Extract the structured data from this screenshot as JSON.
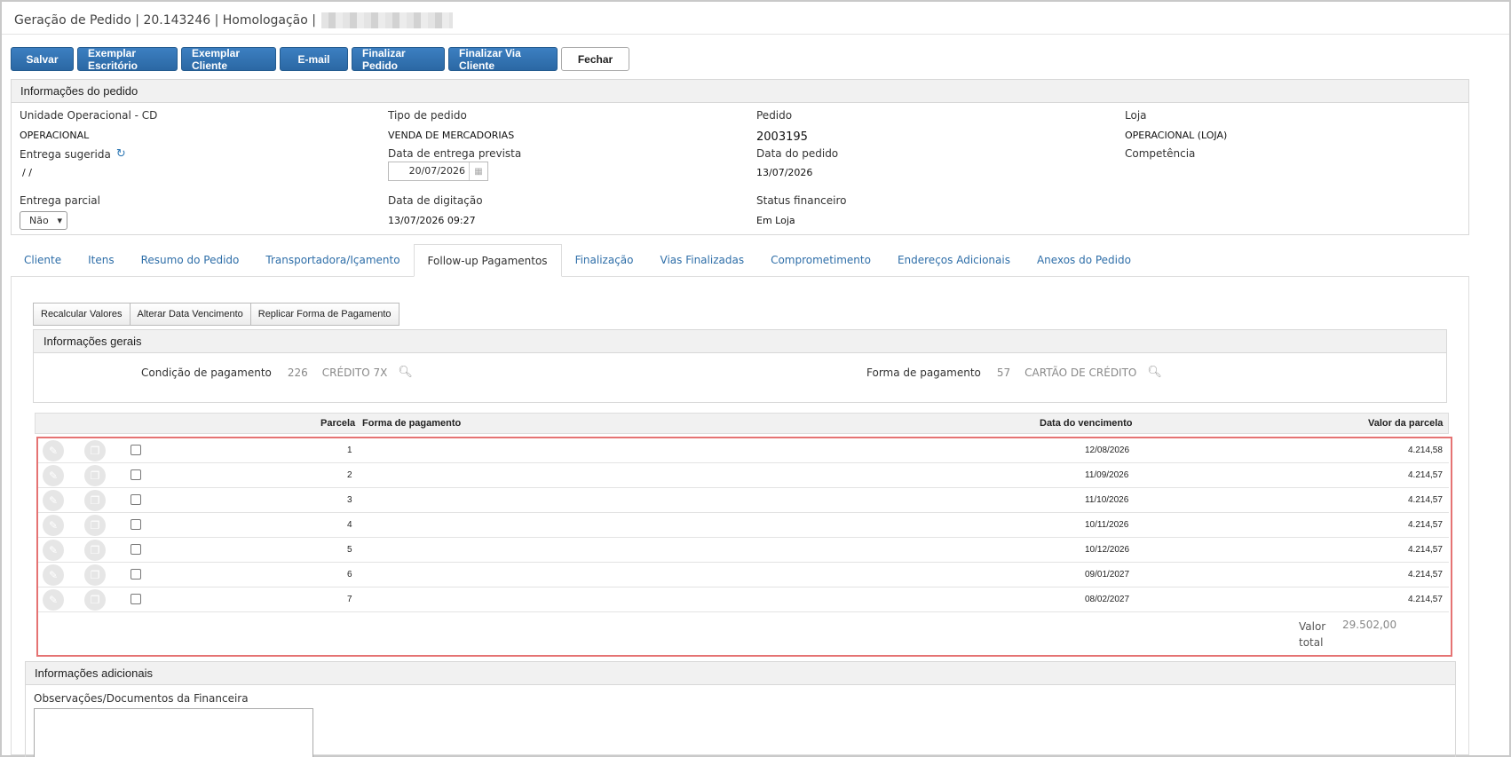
{
  "header": {
    "title": "Geração de Pedido | 20.143246 | Homologação |"
  },
  "toolbar": {
    "buttons": [
      "Salvar",
      "Exemplar Escritório",
      "Exemplar Cliente",
      "E-mail",
      "Finalizar Pedido",
      "Finalizar Via Cliente",
      "Fechar"
    ]
  },
  "order_info": {
    "title": "Informações do pedido",
    "unidade_label": "Unidade Operacional - CD",
    "unidade_value": "OPERACIONAL",
    "tipo_label": "Tipo de pedido",
    "tipo_value": "VENDA DE MERCADORIAS",
    "pedido_label": "Pedido",
    "pedido_value": "2003195",
    "loja_label": "Loja",
    "loja_value": "OPERACIONAL (LOJA)",
    "entrega_sugerida_label": "Entrega sugerida",
    "entrega_sugerida_value": "/ /",
    "data_entrega_label": "Data de entrega prevista",
    "data_entrega_value": "20/07/2026",
    "data_pedido_label": "Data do pedido",
    "data_pedido_value": "13/07/2026",
    "competencia_label": "Competência",
    "entrega_parcial_label": "Entrega parcial",
    "entrega_parcial_value": "Não",
    "data_digitacao_label": "Data de digitação",
    "data_digitacao_value": "13/07/2026 09:27",
    "status_label": "Status financeiro",
    "status_value": "Em Loja"
  },
  "tabs": [
    "Cliente",
    "Itens",
    "Resumo do Pedido",
    "Transportadora/Içamento",
    "Follow-up Pagamentos",
    "Finalização",
    "Vias Finalizadas",
    "Comprometimento",
    "Endereços Adicionais",
    "Anexos do Pedido"
  ],
  "sub_toolbar": [
    "Recalcular Valores",
    "Alterar Data Vencimento",
    "Replicar Forma de Pagamento"
  ],
  "general_info": {
    "title": "Informações gerais",
    "condicao_label": "Condição de pagamento",
    "condicao_code": "226",
    "condicao_desc": "CRÉDITO 7X",
    "forma_label": "Forma de pagamento",
    "forma_code": "57",
    "forma_desc": "CARTÃO DE CRÉDITO"
  },
  "installments": {
    "headers": {
      "parcela": "Parcela",
      "forma": "Forma de pagamento",
      "data": "Data do vencimento",
      "valor": "Valor da parcela"
    },
    "rows": [
      {
        "parcela": "1",
        "data": "12/08/2026",
        "valor": "4.214,58"
      },
      {
        "parcela": "2",
        "data": "11/09/2026",
        "valor": "4.214,57"
      },
      {
        "parcela": "3",
        "data": "11/10/2026",
        "valor": "4.214,57"
      },
      {
        "parcela": "4",
        "data": "10/11/2026",
        "valor": "4.214,57"
      },
      {
        "parcela": "5",
        "data": "10/12/2026",
        "valor": "4.214,57"
      },
      {
        "parcela": "6",
        "data": "09/01/2027",
        "valor": "4.214,57"
      },
      {
        "parcela": "7",
        "data": "08/02/2027",
        "valor": "4.214,57"
      }
    ],
    "total_label_line1": "Valor",
    "total_label_line2": "total",
    "total_value": "29.502,00"
  },
  "additional_info": {
    "title": "Informações adicionais",
    "obs_label": "Observações/Documentos da Financeira"
  }
}
